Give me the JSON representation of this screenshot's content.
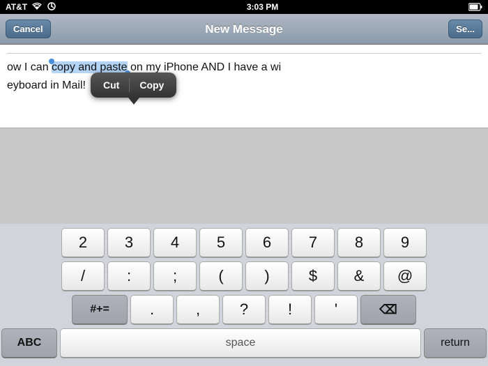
{
  "status": {
    "carrier": "AT&T",
    "time": "3:03 PM",
    "wifi_icon": "wifi",
    "activity_icon": "activity"
  },
  "nav": {
    "cancel_label": "Cancel",
    "title": "New Message",
    "send_label": "Se..."
  },
  "to_field": {
    "placeholder": ""
  },
  "message": {
    "before_selection": "ow I can ",
    "selected": "copy and paste",
    "after_selection": " on my iPhone AND I have a wi",
    "line2": "eyboard in Mail!"
  },
  "context_menu": {
    "cut_label": "Cut",
    "copy_label": "Copy"
  },
  "keyboard": {
    "row1": [
      "2",
      "3",
      "4",
      "5",
      "6",
      "7",
      "8",
      "9"
    ],
    "row2": [
      "/",
      ":",
      ";",
      "(",
      ")",
      "$",
      "&",
      "@"
    ],
    "row3_left": "#+= ",
    "row3_mid": [
      ".",
      ",",
      "?",
      "!",
      "'"
    ],
    "row3_right": "⌫",
    "row4_left": "ABC",
    "row4_space": "space",
    "row4_return": "return"
  }
}
